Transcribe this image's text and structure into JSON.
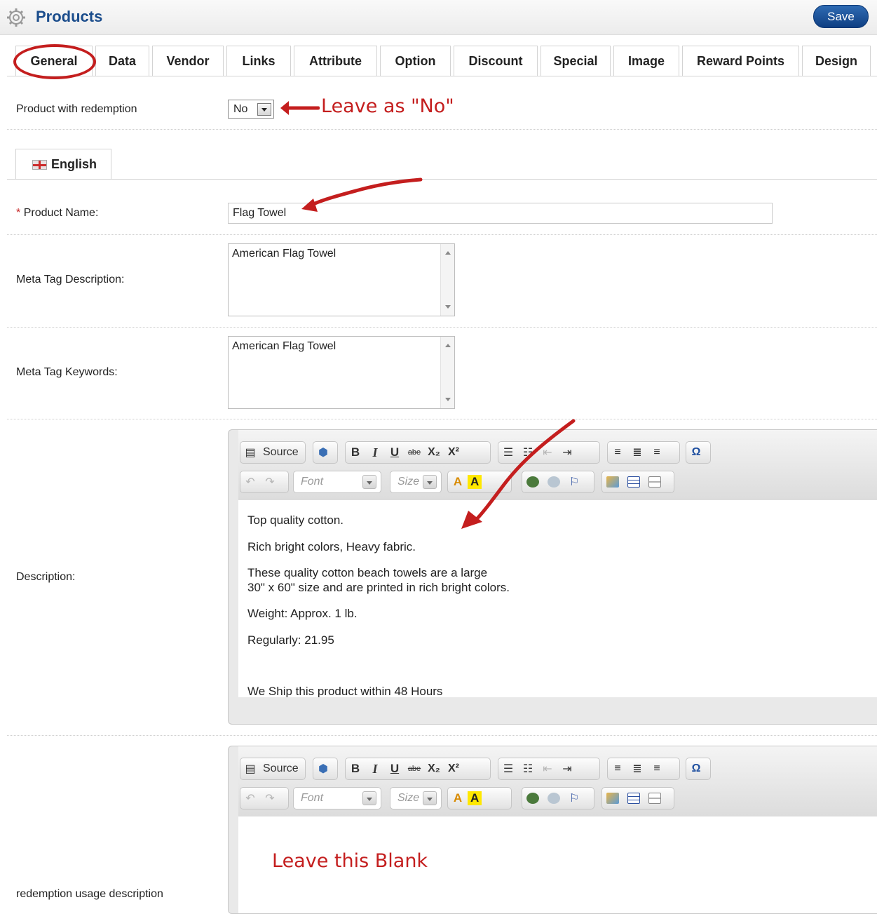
{
  "header": {
    "title": "Products",
    "save_label": "Save"
  },
  "tabs": [
    {
      "label": "General",
      "w": 0
    },
    {
      "label": "Data"
    },
    {
      "label": "Vendor"
    },
    {
      "label": "Links"
    },
    {
      "label": "Attribute"
    },
    {
      "label": "Option"
    },
    {
      "label": "Discount"
    },
    {
      "label": "Special"
    },
    {
      "label": "Image"
    },
    {
      "label": "Reward Points"
    },
    {
      "label": "Design"
    }
  ],
  "redemption": {
    "label": "Product with redemption",
    "value": "No",
    "annotation": "Leave as \"No\""
  },
  "language": {
    "label": "English"
  },
  "product_name": {
    "required_mark": "*",
    "label": "Product Name:",
    "value": "Flag Towel"
  },
  "meta_description": {
    "label": "Meta Tag Description:",
    "value": "American Flag Towel"
  },
  "meta_keywords": {
    "label": "Meta Tag Keywords:",
    "value": "American Flag Towel"
  },
  "description": {
    "label": "Description:",
    "paragraphs": [
      "Top quality cotton.",
      "Rich bright colors, Heavy fabric.",
      "These quality cotton beach towels are a large",
      "30\" x 60\" size and are printed in rich bright colors.",
      "Weight: Approx. 1 lb.",
      "Regularly: 21.95",
      "We Ship this product within 48 Hours"
    ]
  },
  "redemption_usage": {
    "label": "redemption usage description",
    "annotation": "Leave this Blank"
  },
  "editor_toolbar": {
    "source_label": "Source",
    "bold": "B",
    "italic": "I",
    "underline": "U",
    "strike": "abe",
    "subscript": "X₂",
    "superscript": "X²",
    "font_placeholder": "Font",
    "size_placeholder": "Size",
    "omega": "Ω",
    "text_color": "A",
    "bg_color": "A"
  },
  "colors": {
    "accent": "#1b4d8c",
    "annotation": "#c41e1e"
  }
}
